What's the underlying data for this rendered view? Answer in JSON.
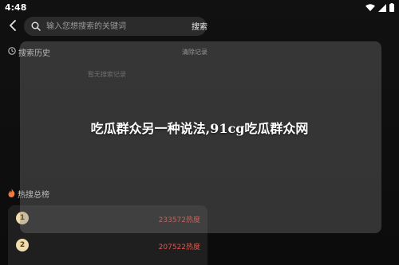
{
  "status_bar": {
    "time": "4:48",
    "icons": [
      "wifi-icon",
      "signal-icon",
      "battery-icon"
    ]
  },
  "header": {
    "back_icon": "chevron-left-icon",
    "search": {
      "icon": "search-icon",
      "placeholder": "输入您想搜索的关键词",
      "value": ""
    },
    "search_button_label": "搜索"
  },
  "history": {
    "icon": "clock-icon",
    "title": "搜索历史",
    "clear_label": "清除记录",
    "empty_text": "暂无搜索记录"
  },
  "hot": {
    "icon": "flame-icon",
    "title": "热搜总榜",
    "items": [
      {
        "rank": "1",
        "heat": "233572热度"
      },
      {
        "rank": "2",
        "heat": "207522热度"
      }
    ]
  },
  "overlay": {
    "text": "吃瓜群众另一种说法,91cg吃瓜群众网"
  },
  "colors": {
    "accent_heat": "#e0584e",
    "rank_badge": "#f1dcae",
    "overlay": "rgba(125,125,125,0.35)"
  }
}
